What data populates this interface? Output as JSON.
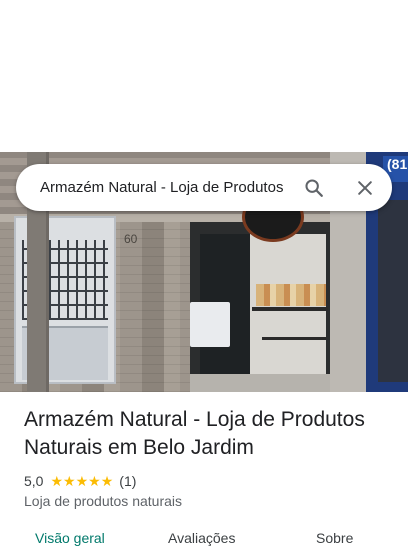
{
  "search": {
    "query": "Armazém Natural - Loja de Produtos"
  },
  "photo": {
    "house_number": "60",
    "sign_partial": "(81"
  },
  "place": {
    "title": "Armazém Natural - Loja de Produtos Naturais em Belo Jardim",
    "rating": "5,0",
    "stars": 5,
    "review_count": "(1)",
    "category": "Loja de produtos naturais"
  },
  "tabs": [
    {
      "label": "Visão geral",
      "active": true
    },
    {
      "label": "Avaliações",
      "active": false
    },
    {
      "label": "Sobre",
      "active": false
    }
  ],
  "colors": {
    "star": "#fbbc04",
    "active_tab": "#00796b"
  }
}
